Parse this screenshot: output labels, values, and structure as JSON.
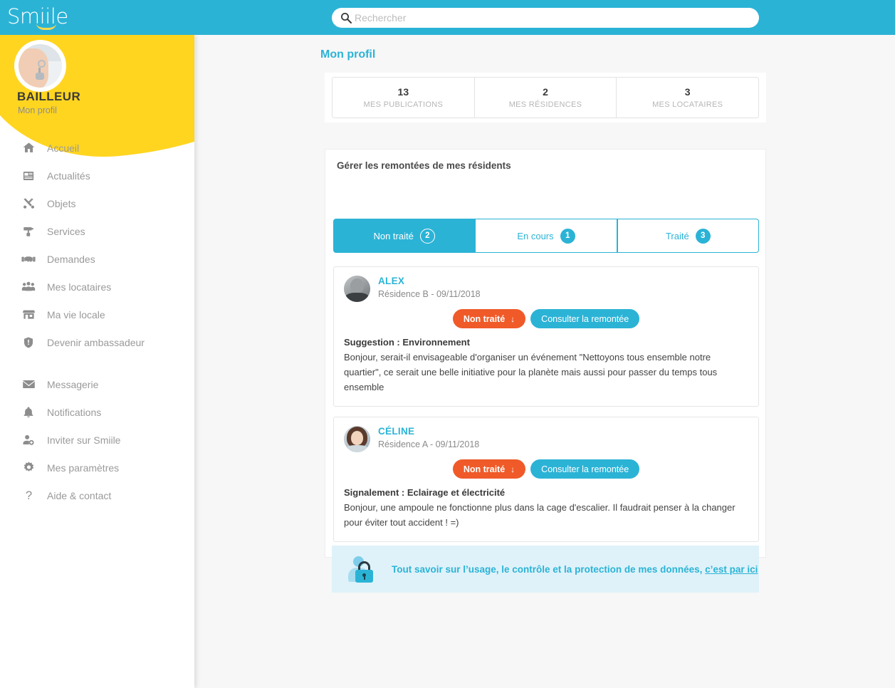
{
  "header": {
    "logo_text": "Smiile",
    "search_placeholder": "Rechercher",
    "search_value": "",
    "search_icon": "search-icon"
  },
  "sidebar": {
    "profile": {
      "name": "BAILLEUR",
      "subtitle": "Mon profil",
      "avatar_alt": "hand-holding-keys-photo"
    },
    "items": [
      {
        "label": "Accueil",
        "icon": "home-icon"
      },
      {
        "label": "Actualités",
        "icon": "newspaper-icon"
      },
      {
        "label": "Objets",
        "icon": "tools-icon"
      },
      {
        "label": "Services",
        "icon": "paint-roller-icon"
      },
      {
        "label": "Demandes",
        "icon": "handshake-icon"
      },
      {
        "label": "Mes locataires",
        "icon": "people-group-icon"
      },
      {
        "label": "Ma vie locale",
        "icon": "storefront-icon"
      },
      {
        "label": "Devenir ambassadeur",
        "icon": "shield-icon"
      }
    ],
    "items_secondary": [
      {
        "label": "Messagerie",
        "icon": "envelope-icon"
      },
      {
        "label": "Notifications",
        "icon": "bell-icon"
      },
      {
        "label": "Inviter sur Smiile",
        "icon": "user-plus-icon"
      },
      {
        "label": "Mes paramètres",
        "icon": "gear-icon"
      },
      {
        "label": "Aide & contact",
        "icon": "question-mark-icon"
      }
    ]
  },
  "main": {
    "page_title": "Mon profil",
    "stats": [
      {
        "value": "13",
        "label": "MES PUBLICATIONS"
      },
      {
        "value": "2",
        "label": "MES RÉSIDENCES"
      },
      {
        "value": "3",
        "label": "MES LOCATAIRES"
      }
    ],
    "remontees": {
      "title": "Gérer les remontées de mes résidents",
      "tabs": [
        {
          "label": "Non traité",
          "count": "2",
          "active": true
        },
        {
          "label": "En cours",
          "count": "1",
          "active": false
        },
        {
          "label": "Traité",
          "count": "3",
          "active": false
        }
      ],
      "cards": [
        {
          "name": "ALEX",
          "meta": "Résidence B - 09/11/2018",
          "status_label": "Non traité",
          "consult_label": "Consulter la remontée",
          "subject": "Suggestion : Environnement",
          "body": "Bonjour, serait-il envisageable d'organiser un événement \"Nettoyons tous ensemble notre quartier\", ce serait une belle initiative pour la planète mais aussi pour passer du temps tous ensemble"
        },
        {
          "name": "CÉLINE",
          "meta": "Résidence A - 09/11/2018",
          "status_label": "Non traité",
          "consult_label": "Consulter la remontée",
          "subject": "Signalement : Eclairage et électricité",
          "body": "Bonjour, une ampoule ne fonctionne plus dans la cage d'escalier. Il faudrait penser à la changer pour éviter tout accident ! =)"
        }
      ]
    },
    "privacy": {
      "text": "Tout savoir sur l’usage, le contrôle et la protection de mes données,",
      "link": "c’est par ici",
      "icon": "privacy-lock-icon"
    }
  },
  "colors": {
    "brand_cyan": "#2bb3d6",
    "accent_yellow": "#ffd520",
    "status_orange": "#ef5a28",
    "page_bg": "#f7f7f7",
    "privacy_bg": "#dff2f9"
  }
}
